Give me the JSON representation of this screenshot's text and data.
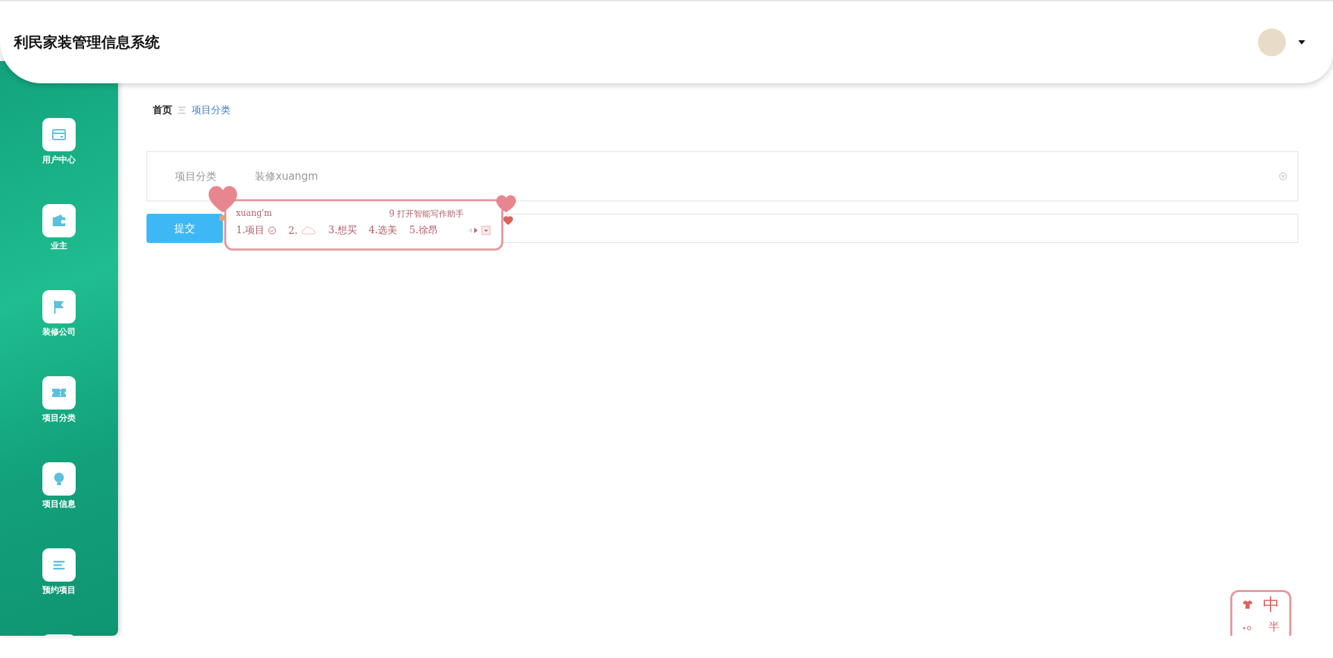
{
  "header": {
    "title": "利民家装管理信息系统"
  },
  "sidebar": {
    "items": [
      {
        "label": "用户中心"
      },
      {
        "label": "业主"
      },
      {
        "label": "装修公司"
      },
      {
        "label": "项目分类"
      },
      {
        "label": "项目信息"
      },
      {
        "label": "预约项目"
      }
    ]
  },
  "breadcrumb": {
    "home": "首页",
    "separator": "三",
    "current": "项目分类"
  },
  "form": {
    "field": {
      "label": "项目分类",
      "value": "装修xuangm"
    },
    "submit": "提交"
  },
  "ime_popup": {
    "composition": "xuang'm",
    "assistant_hint": "9 打开智能写作助手",
    "candidates": [
      {
        "text": "1.项目",
        "kind": "check"
      },
      {
        "text": "2.",
        "kind": "cloud"
      },
      {
        "text": "3.想买",
        "kind": "plain"
      },
      {
        "text": "4.选美",
        "kind": "plain"
      },
      {
        "text": "5.徐昂",
        "kind": "plain"
      }
    ]
  },
  "ime_status": {
    "mode": "中",
    "width": "半"
  }
}
